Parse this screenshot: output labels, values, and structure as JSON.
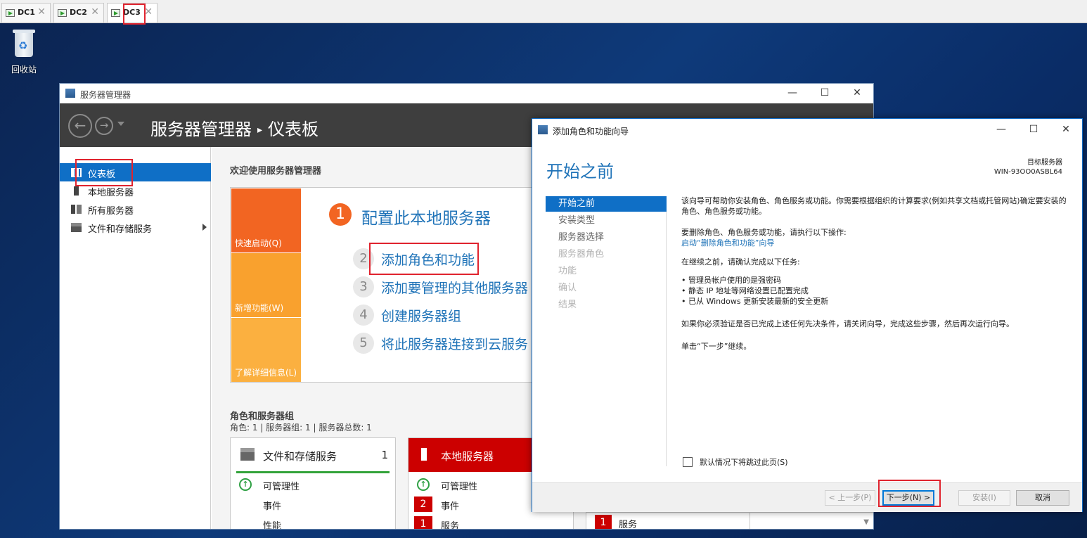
{
  "vm_tabs": [
    {
      "label": "DC1",
      "close": "✕"
    },
    {
      "label": "DC2",
      "close": "✕"
    },
    {
      "label": "DC3",
      "close": "✕"
    }
  ],
  "desktop": {
    "recycle_bin_label": "回收站"
  },
  "server_manager": {
    "window_title": "服务器管理器",
    "breadcrumb_app": "服务器管理器",
    "breadcrumb_sep": "▸",
    "breadcrumb_page": "仪表板",
    "sidebar": [
      {
        "label": "仪表板",
        "icon": "dashboard-icon",
        "selected": true
      },
      {
        "label": "本地服务器",
        "icon": "server-icon"
      },
      {
        "label": "所有服务器",
        "icon": "servers-icon"
      },
      {
        "label": "文件和存储服务",
        "icon": "file-storage-icon"
      }
    ],
    "welcome": "欢迎使用服务器管理器",
    "quick_start": {
      "blocks": [
        "快速启动(Q)",
        "新增功能(W)",
        "了解详细信息(L)"
      ],
      "colors": [
        "#f26522",
        "#f9a12e",
        "#fbb040"
      ],
      "steps": [
        {
          "num": "1",
          "text": "配置此本地服务器"
        },
        {
          "num": "2",
          "text": "添加角色和功能"
        },
        {
          "num": "3",
          "text": "添加要管理的其他服务器"
        },
        {
          "num": "4",
          "text": "创建服务器组"
        },
        {
          "num": "5",
          "text": "将此服务器连接到云服务"
        }
      ]
    },
    "roles": {
      "heading": "角色和服务器组",
      "summary": "角色: 1 | 服务器组: 1 | 服务器总数: 1",
      "tiles": [
        {
          "title": "文件和存储服务",
          "count": "1",
          "rows": [
            {
              "label": "可管理性",
              "status": "ok"
            },
            {
              "label": "事件"
            },
            {
              "label": "性能"
            }
          ]
        },
        {
          "title": "本地服务器",
          "rows": [
            {
              "label": "可管理性",
              "status": "ok"
            },
            {
              "label": "事件",
              "badge": "2"
            },
            {
              "label": "服务",
              "badge": "1"
            }
          ]
        },
        {
          "rows": [
            {
              "label": "服务",
              "badge": "1"
            }
          ]
        }
      ]
    }
  },
  "wizard": {
    "window_title": "添加角色和功能向导",
    "heading": "开始之前",
    "target_label": "目标服务器",
    "target_value": "WIN-93OO0ASBL64",
    "nav": [
      {
        "label": "开始之前",
        "state": "selected"
      },
      {
        "label": "安装类型",
        "state": "enabled"
      },
      {
        "label": "服务器选择",
        "state": "enabled"
      },
      {
        "label": "服务器角色",
        "state": "disabled"
      },
      {
        "label": "功能",
        "state": "disabled"
      },
      {
        "label": "确认",
        "state": "disabled"
      },
      {
        "label": "结果",
        "state": "disabled"
      }
    ],
    "body": {
      "p1": "该向导可帮助你安装角色、角色服务或功能。你需要根据组织的计算要求(例如共享文档或托管网站)确定要安装的角色、角色服务或功能。",
      "p2": "要删除角色、角色服务或功能，请执行以下操作:",
      "link": "启动“删除角色和功能”向导",
      "p3": "在继续之前，请确认完成以下任务:",
      "bullets": [
        "• 管理员帐户使用的是强密码",
        "• 静态 IP 地址等网络设置已配置完成",
        "• 已从 Windows 更新安装最新的安全更新"
      ],
      "p4": "如果你必须验证是否已完成上述任何先决条件，请关闭向导，完成这些步骤，然后再次运行向导。",
      "p5": "单击“下一步”继续。"
    },
    "skip_label": "默认情况下将跳过此页(S)",
    "buttons": {
      "prev": "< 上一步(P)",
      "next": "下一步(N) >",
      "install": "安装(I)",
      "cancel": "取消"
    }
  }
}
